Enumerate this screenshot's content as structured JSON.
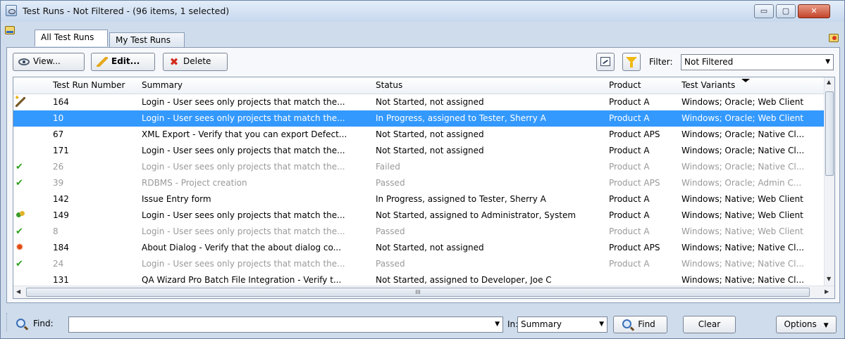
{
  "window": {
    "title": "Test Runs - Not Filtered - (96 items, 1 selected)",
    "controls": {
      "minimize": "▭",
      "maximize": "▢",
      "close": "✕"
    }
  },
  "tabs": [
    {
      "label": "All Test Runs",
      "active": true
    },
    {
      "label": "My Test Runs",
      "active": false
    }
  ],
  "toolbar": {
    "view_label": "View...",
    "edit_label": "Edit...",
    "delete_label": "Delete",
    "filter_label": "Filter:",
    "filter_value": "Not Filtered"
  },
  "grid": {
    "columns": [
      "Test Run Number",
      "Summary",
      "Status",
      "Product",
      "Test Variants"
    ],
    "rows": [
      {
        "icon": "wand-icon",
        "num": "164",
        "summary": "Login - User sees only projects that match the...",
        "status": "Not Started, not assigned",
        "product": "Product A",
        "variants": "Windows; Oracle; Web Client",
        "state": "normal"
      },
      {
        "icon": "",
        "num": "10",
        "summary": "Login - User sees only projects that match the...",
        "status": "In Progress, assigned to Tester, Sherry A",
        "product": "Product A",
        "variants": "Windows; Oracle; Web Client",
        "state": "selected"
      },
      {
        "icon": "",
        "num": "67",
        "summary": "XML Export - Verify that you can export Defect...",
        "status": "Not Started, not assigned",
        "product": "Product APS",
        "variants": "Windows; Oracle; Native Cl...",
        "state": "normal"
      },
      {
        "icon": "",
        "num": "171",
        "summary": "Login - User sees only projects that match the...",
        "status": "Not Started, not assigned",
        "product": "Product A",
        "variants": "Windows; Oracle; Native Cl...",
        "state": "normal"
      },
      {
        "icon": "check-icon",
        "num": "26",
        "summary": "Login - User sees only projects that match the...",
        "status": "Failed",
        "product": "Product A",
        "variants": "Windows; Oracle; Native Cl...",
        "state": "dim"
      },
      {
        "icon": "check-icon",
        "num": "39",
        "summary": "RDBMS - Project creation",
        "status": "Passed",
        "product": "Product APS",
        "variants": "Windows; Oracle; Admin C...",
        "state": "dim"
      },
      {
        "icon": "",
        "num": "142",
        "summary": "Issue Entry form",
        "status": "In Progress, assigned to Tester, Sherry A",
        "product": "Product A",
        "variants": "Windows; Native; Web Client",
        "state": "normal"
      },
      {
        "icon": "users-icon",
        "num": "149",
        "summary": "Login - User sees only projects that match the...",
        "status": "Not Started, assigned to Administrator, System",
        "product": "Product A",
        "variants": "Windows; Native; Web Client",
        "state": "normal"
      },
      {
        "icon": "check-icon",
        "num": "8",
        "summary": "Login - User sees only projects that match the...",
        "status": "Passed",
        "product": "Product A",
        "variants": "Windows; Native; Web Client",
        "state": "dim"
      },
      {
        "icon": "burst-icon",
        "num": "184",
        "summary": "About Dialog - Verify that the about dialog co...",
        "status": "Not Started, not assigned",
        "product": "Product APS",
        "variants": "Windows; Native; Native Cl...",
        "state": "normal"
      },
      {
        "icon": "check-icon",
        "num": "24",
        "summary": "Login - User sees only projects that match the...",
        "status": "Passed",
        "product": "Product A",
        "variants": "Windows; Native; Native Cl...",
        "state": "dim"
      },
      {
        "icon": "",
        "num": "131",
        "summary": "QA Wizard Pro Batch File Integration - Verify t...",
        "status": "Not Started, assigned to Developer, Joe C",
        "product": "",
        "variants": "Windows; Native; Native Cl...",
        "state": "normal"
      }
    ],
    "scroll_grip": "III"
  },
  "findbar": {
    "find_label": "Find:",
    "find_value": "",
    "in_label": "In:",
    "in_value": "Summary",
    "find_button": "Find",
    "clear_button": "Clear",
    "options_button": "Options"
  },
  "colors": {
    "selection": "#3399ff",
    "dim_text": "#9a9a9a",
    "passed_check": "#2ca01c"
  }
}
